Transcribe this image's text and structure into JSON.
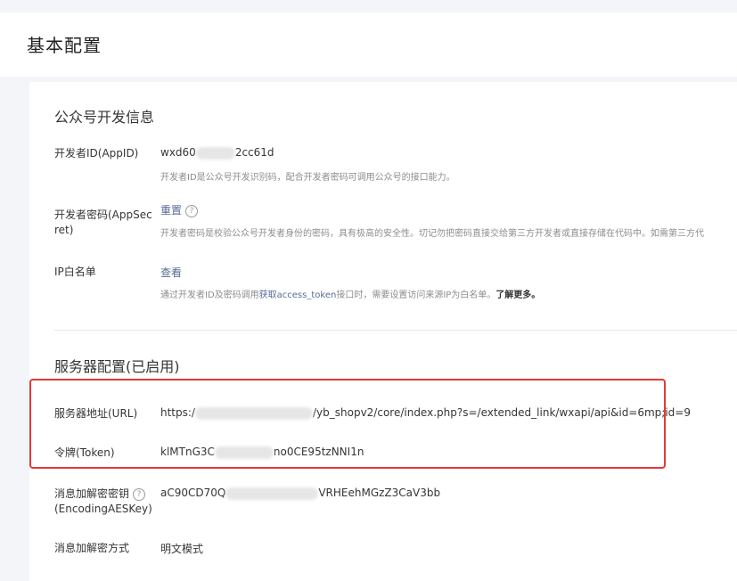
{
  "page": {
    "title": "基本配置"
  },
  "dev_info": {
    "title": "公众号开发信息",
    "appid": {
      "label": "开发者ID(AppID)",
      "value_start": "wxd60",
      "value_end": "2cc61d",
      "desc": "开发者ID是公众号开发识别码，配合开发者密码可调用公众号的接口能力。"
    },
    "appsecret": {
      "label_line1": "开发者密码(AppSec",
      "label_line2": "ret)",
      "action": "重置",
      "desc": "开发者密码是校验公众号开发者身份的密码，具有极高的安全性。切记勿把密码直接交给第三方开发者或直接存储在代码中。如需第三方代"
    },
    "ip_whitelist": {
      "label": "IP白名单",
      "action": "查看",
      "desc_prefix": "通过开发者ID及密码调用",
      "desc_link": "获取access_token",
      "desc_mid": "接口时，需要设置访问来源IP为白名单。",
      "desc_more": "了解更多。"
    }
  },
  "server_config": {
    "title": "服务器配置(已启用)",
    "url": {
      "label": "服务器地址(URL)",
      "value_start": "https:/",
      "value_end": "/yb_shopv2/core/index.php?s=/extended_link/wxapi/api&id=6mp;id=9"
    },
    "token": {
      "label": "令牌(Token)",
      "value_start": "klMTnG3C",
      "value_end": "no0CE95tzNNI1n"
    },
    "aeskey": {
      "label_line1": "消息加解密密钥",
      "label_line2": "(EncodingAESKey)",
      "value_start": "aC90CD70Q",
      "value_end": "VRHEehMGzZ3CaV3bb"
    },
    "encrypt_mode": {
      "label": "消息加解密方式",
      "value": "明文模式"
    }
  },
  "icons": {
    "help": "?"
  },
  "colors": {
    "highlight_border": "#e53935",
    "link": "#576b95"
  }
}
